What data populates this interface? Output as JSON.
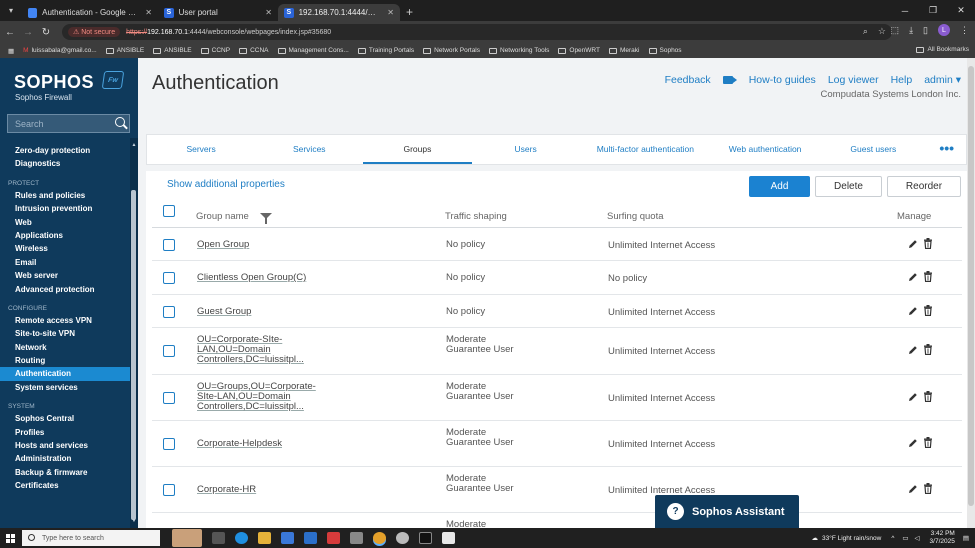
{
  "browser": {
    "tabs": [
      {
        "label": "Authentication - Google Docs",
        "icon": "docs-icon",
        "active": false
      },
      {
        "label": "User portal",
        "icon": "sophos-icon",
        "active": false
      },
      {
        "label": "192.168.70.1:4444/webconsole",
        "icon": "sophos-icon",
        "active": true
      }
    ],
    "security_label": "Not secure",
    "url_scheme": "https://",
    "url_host": "192.168.70.1",
    "url_rest": ":4444/webconsole/webpages/index.jsp#35680",
    "bookmarks": [
      "luissabala@gmail.co...",
      "ANSIBLE",
      "ANSIBLE",
      "CCNP",
      "CCNA",
      "Management Cons...",
      "Training Portals",
      "Network Portals",
      "Networking Tools",
      "OpenWRT",
      "Meraki",
      "Sophos"
    ],
    "all_bookmarks": "All Bookmarks",
    "profile_initial": "L"
  },
  "sidebar": {
    "brand": "SOPHOS",
    "badge": "Fw",
    "product": "Sophos Firewall",
    "search_placeholder": "Search",
    "top_items": [
      "Zero-day protection",
      "Diagnostics"
    ],
    "protect_head": "PROTECT",
    "protect_items": [
      "Rules and policies",
      "Intrusion prevention",
      "Web",
      "Applications",
      "Wireless",
      "Email",
      "Web server",
      "Advanced protection"
    ],
    "configure_head": "CONFIGURE",
    "configure_items": [
      "Remote access VPN",
      "Site-to-site VPN",
      "Network",
      "Routing",
      "Authentication",
      "System services"
    ],
    "system_head": "SYSTEM",
    "system_items": [
      "Sophos Central",
      "Profiles",
      "Hosts and services",
      "Administration",
      "Backup & firmware",
      "Certificates"
    ],
    "active_item": "Authentication"
  },
  "header": {
    "title": "Authentication",
    "feedback": "Feedback",
    "howto": "How-to guides",
    "log_viewer": "Log viewer",
    "help": "Help",
    "admin": "admin ▾",
    "org": "Compudata Systems London Inc."
  },
  "tabs": [
    "Servers",
    "Services",
    "Groups",
    "Users",
    "Multi-factor authentication",
    "Web authentication",
    "Guest users"
  ],
  "active_tab": "Groups",
  "toolbar": {
    "show_props": "Show additional properties",
    "add": "Add",
    "delete": "Delete",
    "reorder": "Reorder"
  },
  "table": {
    "headers": {
      "name": "Group name",
      "shaping": "Traffic shaping",
      "quota": "Surfing quota",
      "manage": "Manage"
    },
    "rows": [
      {
        "name": "Open Group",
        "shaping": "No policy",
        "quota": "Unlimited Internet Access"
      },
      {
        "name": "Clientless Open Group(C)",
        "shaping": "No policy",
        "quota": "No policy"
      },
      {
        "name": "Guest Group",
        "shaping": "No policy",
        "quota": "Unlimited Internet Access"
      },
      {
        "name": "OU=Corporate-SIte-LAN,OU=Domain Controllers,DC=luissitpl...",
        "shaping": "Moderate Guarantee User",
        "quota": "Unlimited Internet Access"
      },
      {
        "name": "OU=Groups,OU=Corporate-SIte-LAN,OU=Domain Controllers,DC=luissitpl...",
        "shaping": "Moderate Guarantee User",
        "quota": "Unlimited Internet Access"
      },
      {
        "name": "Corporate-Helpdesk",
        "shaping": "Moderate Guarantee User",
        "quota": "Unlimited Internet Access"
      },
      {
        "name": "Corporate-HR",
        "shaping": "Moderate Guarantee User",
        "quota": "Unlimited Internet Access"
      },
      {
        "name": "",
        "shaping": "Moderate",
        "quota": ""
      }
    ]
  },
  "assistant": {
    "label": "Sophos Assistant"
  },
  "taskbar": {
    "search": "Type here to search",
    "weather": "33°F  Light rain/snow",
    "time": "3:42 PM",
    "date": "3/7/2025"
  },
  "colors": {
    "sidebar": "#0f3a5c",
    "accent": "#1b82d1",
    "active_nav": "#1b8ad1"
  }
}
